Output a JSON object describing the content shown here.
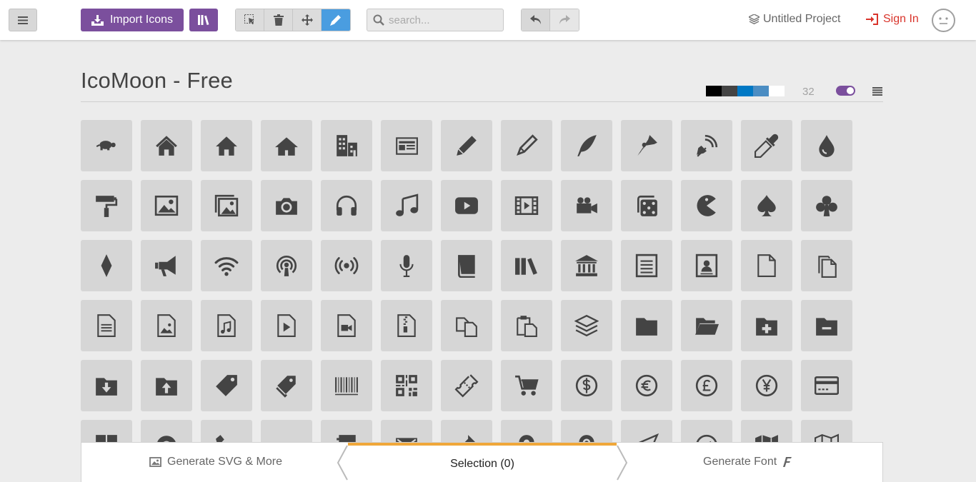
{
  "toolbar": {
    "menu_icon": "hamburger-icon",
    "import_label": "Import Icons",
    "import_icon": "import-icon",
    "library_icon": "library-icon",
    "tools": [
      {
        "name": "select-tool",
        "icon": "cursor-icon",
        "active": false
      },
      {
        "name": "delete-tool",
        "icon": "trash-icon",
        "active": false
      },
      {
        "name": "move-tool",
        "icon": "move-icon",
        "active": true
      },
      {
        "name": "edit-tool",
        "icon": "pencil-icon",
        "active": true
      }
    ],
    "search_placeholder": "search...",
    "undo_icon": "undo-icon",
    "redo_icon": "redo-icon"
  },
  "header_right": {
    "project_label": "Untitled Project",
    "signin_label": "Sign In"
  },
  "icon_set": {
    "title": "IcoMoon - Free",
    "swatches": [
      "#000000",
      "#444444",
      "#0078c4",
      "#4b8dc3",
      "#ffffff"
    ],
    "grid_size": "32",
    "toggle_on": true
  },
  "icons": [
    "tortoise-icon",
    "home-icon",
    "home2-icon",
    "home3-icon",
    "office-icon",
    "newspaper-icon",
    "pencil-icon",
    "pencil2-icon",
    "quill-icon",
    "pen-icon",
    "blog-icon",
    "eyedropper-icon",
    "droplet-icon",
    "paint-format-icon",
    "image-icon",
    "images-icon",
    "camera-icon",
    "headphones-icon",
    "music-icon",
    "play-icon",
    "film-icon",
    "video-camera-icon",
    "dice-icon",
    "pacman-icon",
    "spades-icon",
    "clubs-icon",
    "diamonds-icon",
    "bullhorn-icon",
    "connection-icon",
    "podcast-icon",
    "feed-icon",
    "mic-icon",
    "book-icon",
    "books-icon",
    "library-icon",
    "file-text-icon",
    "profile-icon",
    "file-empty-icon",
    "files-empty-icon",
    "file-text2-icon",
    "file-picture-icon",
    "file-music-icon",
    "file-play-icon",
    "file-video-icon",
    "file-zip-icon",
    "copy-icon",
    "paste-icon",
    "stack-icon",
    "folder-icon",
    "folder-open-icon",
    "folder-plus-icon",
    "folder-minus-icon",
    "folder-download-icon",
    "folder-upload-icon",
    "price-tag-icon",
    "price-tags-icon",
    "barcode-icon",
    "qrcode-icon",
    "ticket-icon",
    "cart-icon",
    "coin-dollar-icon",
    "coin-euro-icon",
    "coin-pound-icon",
    "coin-yen-icon",
    "credit-card-icon",
    "calculator-icon",
    "lifebuoy-icon",
    "phone-icon",
    "phone-hang-up-icon",
    "address-book-icon",
    "envelop-icon",
    "pushpin-icon",
    "location-icon",
    "location2-icon",
    "compass-icon",
    "compass2-icon",
    "map-icon",
    "map2-icon"
  ],
  "bottom": {
    "generate_svg_label": "Generate SVG & More",
    "selection_label": "Selection (0)",
    "generate_font_label": "Generate Font"
  }
}
